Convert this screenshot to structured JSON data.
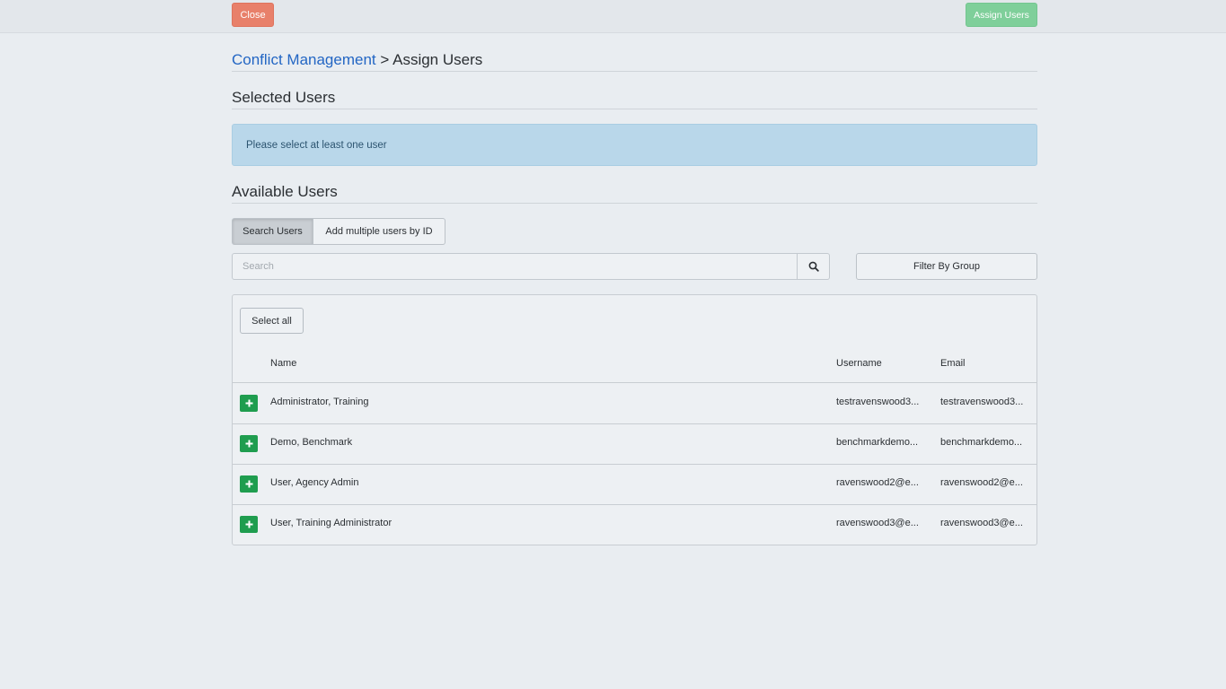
{
  "topbar": {
    "close_label": "Close",
    "assign_label": "Assign Users"
  },
  "breadcrumb": {
    "parent": "Conflict Management",
    "separator": ">",
    "current": "Assign Users"
  },
  "selected_users": {
    "title": "Selected Users",
    "alert": "Please select at least one user"
  },
  "available_users": {
    "title": "Available Users",
    "tabs": [
      {
        "label": "Search Users",
        "active": true
      },
      {
        "label": "Add multiple users by ID",
        "active": false
      }
    ],
    "search": {
      "placeholder": "Search",
      "value": ""
    },
    "filter_label": "Filter By Group",
    "select_all_label": "Select all",
    "columns": {
      "name": "Name",
      "username": "Username",
      "email": "Email"
    },
    "rows": [
      {
        "name": "Administrator, Training",
        "username": "testravenswood3...",
        "email": "testravenswood3..."
      },
      {
        "name": "Demo, Benchmark",
        "username": "benchmarkdemo...",
        "email": "benchmarkdemo..."
      },
      {
        "name": "User, Agency Admin",
        "username": "ravenswood2@e...",
        "email": "ravenswood2@e..."
      },
      {
        "name": "User, Training Administrator",
        "username": "ravenswood3@e...",
        "email": "ravenswood3@e..."
      }
    ]
  },
  "colors": {
    "close": "#e8806a",
    "assign": "#7fcf9a",
    "add": "#1f9d4f",
    "link": "#2366c4",
    "alert_bg": "#b9d7ea"
  },
  "icons": {
    "search_button": "search-icon",
    "row_add": "plus-icon"
  }
}
